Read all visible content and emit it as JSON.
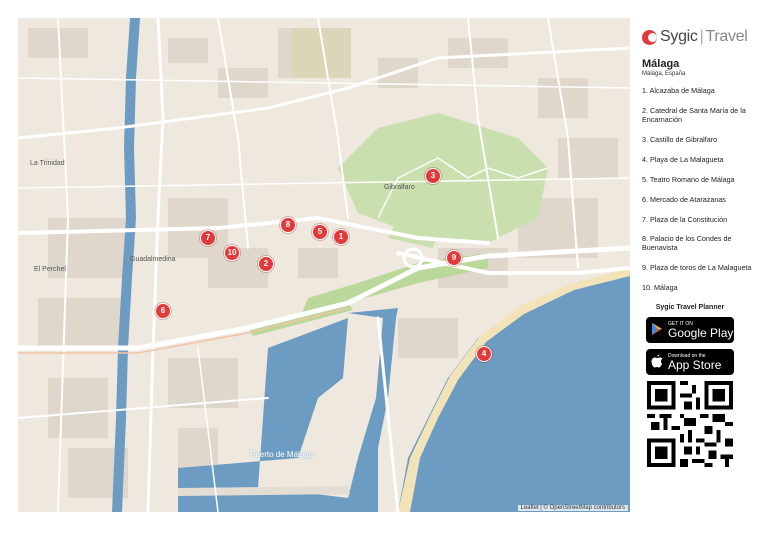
{
  "brand": {
    "name": "Sygic",
    "separator": "|",
    "product": "Travel"
  },
  "city": {
    "name": "Málaga",
    "region": "Málaga, España"
  },
  "places": [
    {
      "num": "1",
      "label": "1. Alcazaba de Málaga"
    },
    {
      "num": "2",
      "label": "2. Catedral de Santa María de la Encarnación"
    },
    {
      "num": "3",
      "label": "3. Castillo de Gibralfaro"
    },
    {
      "num": "4",
      "label": "4. Playa de La Malagueta"
    },
    {
      "num": "5",
      "label": "5. Teatro Romano de Málaga"
    },
    {
      "num": "6",
      "label": "6. Mercado de Atarazanas"
    },
    {
      "num": "7",
      "label": "7. Plaza de la Constitución"
    },
    {
      "num": "8",
      "label": "8. Palacio de los Condes de Buenavista"
    },
    {
      "num": "9",
      "label": "9. Plaza de toros de La Malagueta"
    },
    {
      "num": "10",
      "label": "10. Málaga"
    }
  ],
  "planner": {
    "title": "Sygic Travel Planner",
    "google": {
      "top": "GET IT ON",
      "main": "Google Play",
      "icon": "google-play-icon"
    },
    "apple": {
      "top": "Download on the",
      "main": "App Store",
      "icon": "apple-icon"
    }
  },
  "map": {
    "labels": {
      "trinidad": "La Trinidad",
      "perchel": "El Perchel",
      "guadalmedina": "Guadalmedina",
      "gibralfaro": "Gibralfaro",
      "puerto": "Puerto de Málaga"
    },
    "attribution": "Leaflet | © OpenStreetMap contributors",
    "colors": {
      "water": "#6d9cc2",
      "park": "#c9dfae",
      "marker": "#e2393b",
      "land": "#eee8df",
      "beach": "#f2e4b8"
    }
  }
}
